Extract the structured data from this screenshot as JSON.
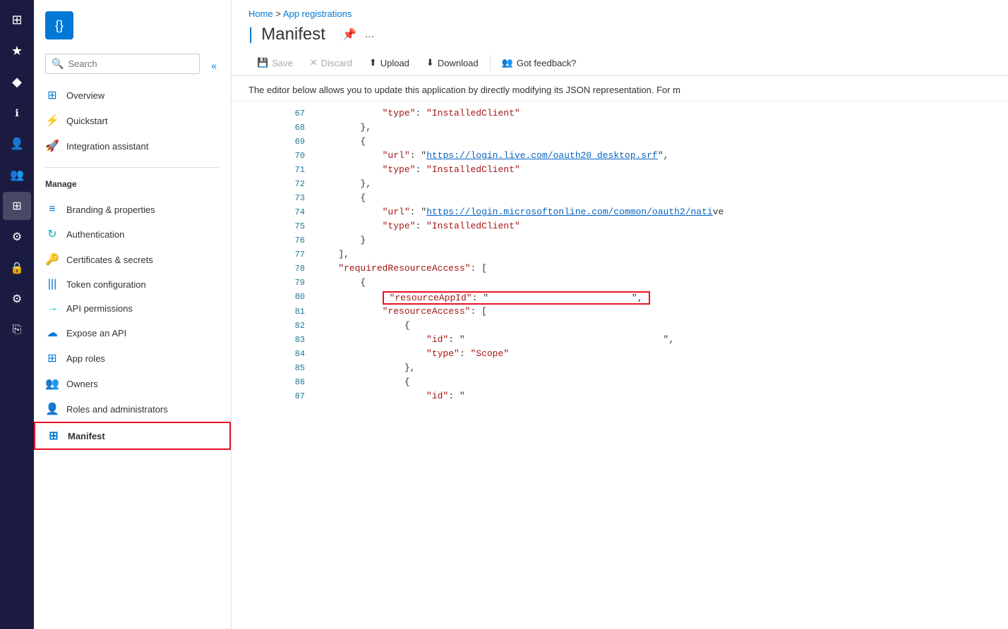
{
  "iconBar": {
    "items": [
      {
        "name": "home-icon",
        "icon": "⊞",
        "active": false
      },
      {
        "name": "favorites-icon",
        "icon": "★",
        "active": false
      },
      {
        "name": "diamond-icon",
        "icon": "◆",
        "active": false
      },
      {
        "name": "info-icon",
        "icon": "ℹ",
        "active": false
      },
      {
        "name": "user-icon",
        "icon": "👤",
        "active": false
      },
      {
        "name": "users-icon",
        "icon": "👥",
        "active": false
      },
      {
        "name": "grid-icon",
        "icon": "⊞",
        "active": true
      },
      {
        "name": "settings-icon",
        "icon": "⚙",
        "active": false
      },
      {
        "name": "lock-icon",
        "icon": "🔒",
        "active": false
      },
      {
        "name": "cog-icon",
        "icon": "⚙",
        "active": false
      },
      {
        "name": "copy-icon",
        "icon": "⎘",
        "active": false
      }
    ]
  },
  "sidebar": {
    "searchPlaceholder": "Search",
    "appIconLabel": "{}",
    "nav": [
      {
        "label": "Overview",
        "icon": "⊞",
        "iconClass": "blue",
        "active": false
      },
      {
        "label": "Quickstart",
        "icon": "🚀",
        "iconClass": "teal",
        "active": false
      },
      {
        "label": "Integration assistant",
        "icon": "🚀",
        "iconClass": "orange",
        "active": false
      }
    ],
    "manageTitle": "Manage",
    "manageItems": [
      {
        "label": "Branding & properties",
        "icon": "≡",
        "iconClass": "blue",
        "active": false
      },
      {
        "label": "Authentication",
        "icon": "↻",
        "iconClass": "teal",
        "active": false
      },
      {
        "label": "Certificates & secrets",
        "icon": "🔑",
        "iconClass": "yellow",
        "active": false
      },
      {
        "label": "Token configuration",
        "icon": "|||",
        "iconClass": "blue",
        "active": false
      },
      {
        "label": "API permissions",
        "icon": "→",
        "iconClass": "teal",
        "active": false
      },
      {
        "label": "Expose an API",
        "icon": "☁",
        "iconClass": "blue",
        "active": false
      },
      {
        "label": "App roles",
        "icon": "⊞",
        "iconClass": "blue",
        "active": false
      },
      {
        "label": "Owners",
        "icon": "👥",
        "iconClass": "teal",
        "active": false
      },
      {
        "label": "Roles and administrators",
        "icon": "👤",
        "iconClass": "green",
        "active": false
      },
      {
        "label": "Manifest",
        "icon": "⊞",
        "iconClass": "manifest",
        "active": true
      }
    ]
  },
  "breadcrumb": {
    "home": "Home",
    "separator": ">",
    "appReg": "App registrations"
  },
  "header": {
    "title": "Manifest",
    "pinLabel": "📌",
    "moreLabel": "..."
  },
  "toolbar": {
    "saveLabel": "Save",
    "discardLabel": "Discard",
    "uploadLabel": "Upload",
    "downloadLabel": "Download",
    "feedbackLabel": "Got feedback?"
  },
  "description": "The editor below allows you to update this application by directly modifying its JSON representation. For m",
  "codeLines": [
    {
      "num": 67,
      "content": "\"type\": \"InstalledClient\"",
      "indent": 4
    },
    {
      "num": 68,
      "content": "},",
      "indent": 3
    },
    {
      "num": 69,
      "content": "{",
      "indent": 3
    },
    {
      "num": 70,
      "content": "\"url\": \"https://login.live.com/oauth20_desktop.srf\",",
      "indent": 4,
      "hasLink": true,
      "linkText": "https://login.live.com/oauth20_desktop.srf"
    },
    {
      "num": 71,
      "content": "\"type\": \"InstalledClient\"",
      "indent": 4
    },
    {
      "num": 72,
      "content": "},",
      "indent": 3
    },
    {
      "num": 73,
      "content": "{",
      "indent": 3
    },
    {
      "num": 74,
      "content": "\"url\": \"https://login.microsoftonline.com/common/oauth2/nati",
      "indent": 4,
      "hasLink": true,
      "linkText": "https://login.microsoftonline.com/common/oauth2/nati",
      "truncated": true
    },
    {
      "num": 75,
      "content": "\"type\": \"InstalledClient\"",
      "indent": 4
    },
    {
      "num": 76,
      "content": "}",
      "indent": 3
    },
    {
      "num": 77,
      "content": "],",
      "indent": 2
    },
    {
      "num": 78,
      "content": "\"requiredResourceAccess\": [",
      "indent": 2
    },
    {
      "num": 79,
      "content": "{",
      "indent": 3
    },
    {
      "num": 80,
      "content": "\"resourceAppId\": \"                              \",",
      "indent": 4,
      "highlighted": true
    },
    {
      "num": 81,
      "content": "\"resourceAccess\": [",
      "indent": 4
    },
    {
      "num": 82,
      "content": "{",
      "indent": 5
    },
    {
      "num": 83,
      "content": "\"id\": \"                                    \",",
      "indent": 6
    },
    {
      "num": 84,
      "content": "\"type\": \"Scope\"",
      "indent": 6
    },
    {
      "num": 85,
      "content": "},",
      "indent": 5
    },
    {
      "num": 86,
      "content": "{",
      "indent": 5
    },
    {
      "num": 87,
      "content": "\"id\": \"",
      "indent": 6,
      "truncated": true
    }
  ],
  "colors": {
    "accent": "#0078d4",
    "highlight": "#e81123",
    "activeNav": "#deecf9"
  }
}
